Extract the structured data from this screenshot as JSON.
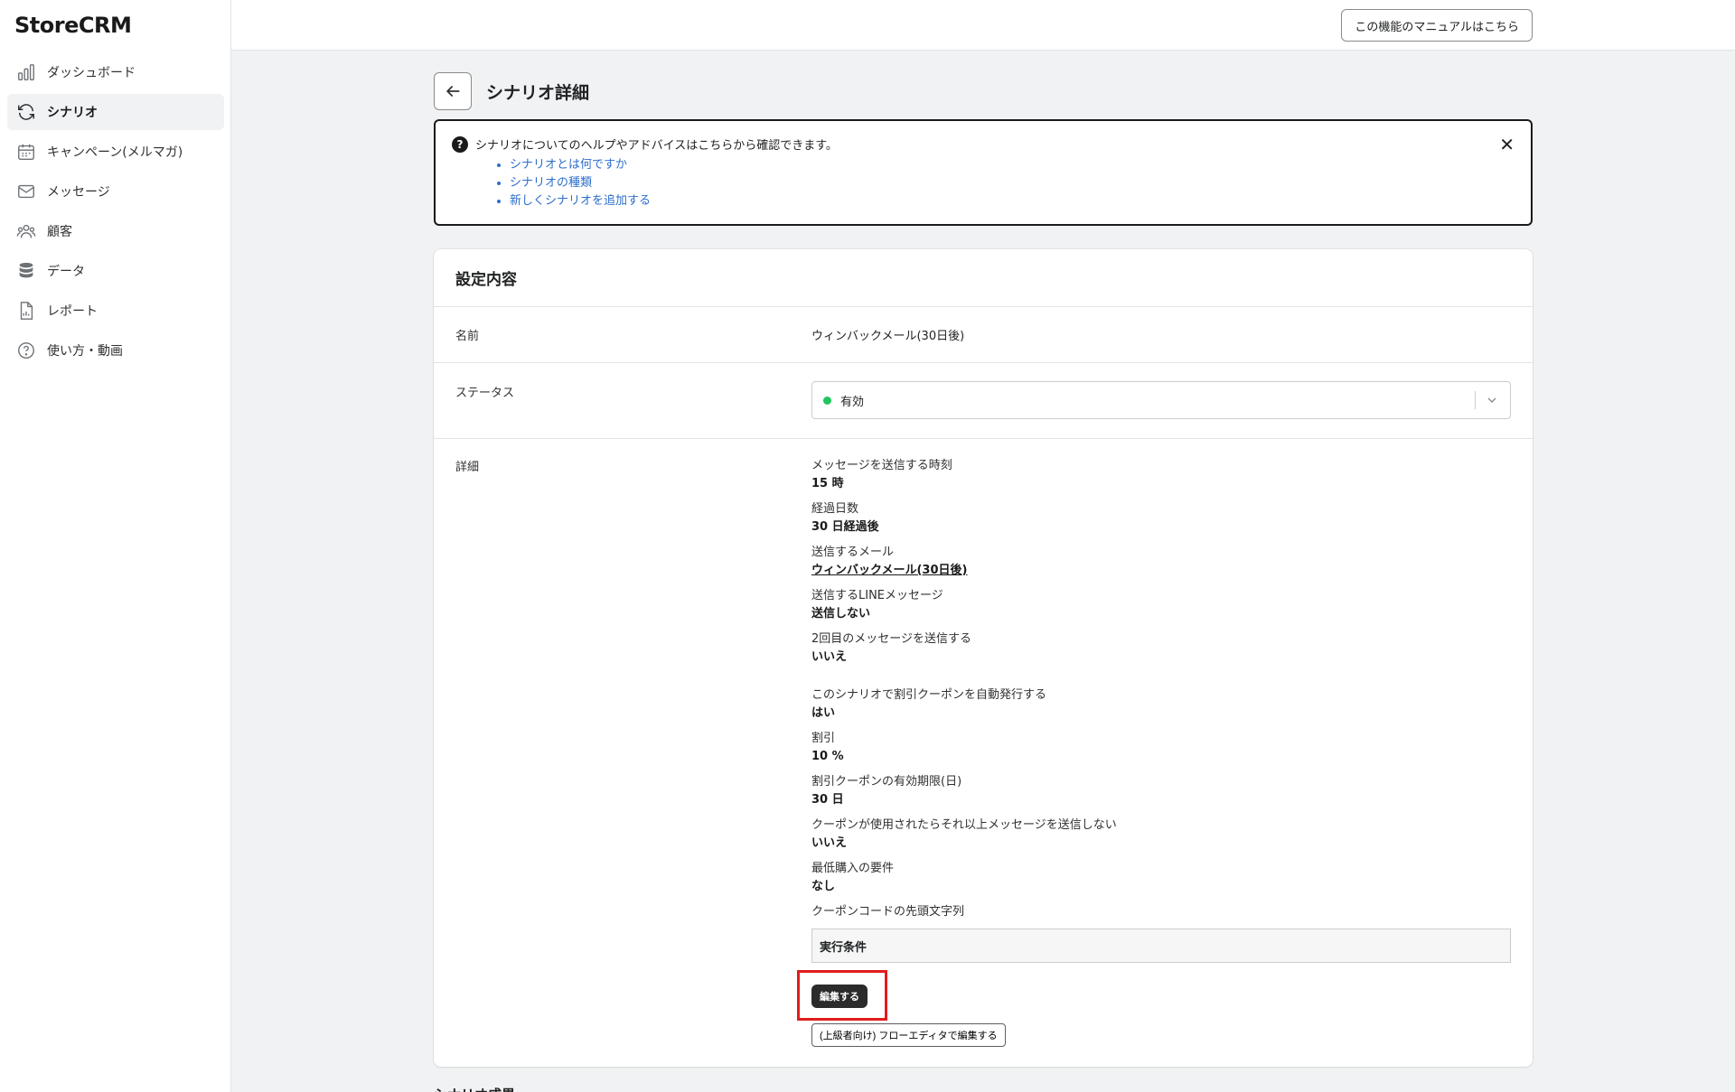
{
  "app": {
    "logo": "StoreCRM"
  },
  "sidebar": {
    "items": [
      {
        "label": "ダッシュボード",
        "icon": "bar-chart-icon"
      },
      {
        "label": "シナリオ",
        "icon": "refresh-icon",
        "active": true
      },
      {
        "label": "キャンペーン(メルマガ)",
        "icon": "calendar-icon"
      },
      {
        "label": "メッセージ",
        "icon": "mail-icon"
      },
      {
        "label": "顧客",
        "icon": "users-icon"
      },
      {
        "label": "データ",
        "icon": "database-icon"
      },
      {
        "label": "レポート",
        "icon": "report-icon"
      },
      {
        "label": "使い方・動画",
        "icon": "help-circle-icon"
      }
    ]
  },
  "topbar": {
    "manual_button": "この機能のマニュアルはこちら"
  },
  "page": {
    "title": "シナリオ詳細"
  },
  "help": {
    "heading": "シナリオについてのヘルプやアドバイスはこちらから確認できます。",
    "links": [
      "シナリオとは何ですか",
      "シナリオの種類",
      "新しくシナリオを追加する"
    ]
  },
  "settings": {
    "title": "設定内容",
    "name_label": "名前",
    "name_value": "ウィンバックメール(30日後)",
    "status_label": "ステータス",
    "status_value": "有効",
    "status_color": "#22c55e",
    "detail_label": "詳細",
    "details": [
      {
        "label": "メッセージを送信する時刻",
        "value": "15 時"
      },
      {
        "label": "経過日数",
        "value": "30 日経過後"
      },
      {
        "label": "送信するメール",
        "value": "ウィンバックメール(30日後)"
      },
      {
        "label": "送信するLINEメッセージ",
        "value": "送信しない"
      },
      {
        "label": "2回目のメッセージを送信する",
        "value": "いいえ"
      },
      {
        "label": "このシナリオで割引クーポンを自動発行する",
        "value": "はい"
      },
      {
        "label": "割引",
        "value": "10 %"
      },
      {
        "label": "割引クーポンの有効期限(日)",
        "value": "30 日"
      },
      {
        "label": "クーポンが使用されたらそれ以上メッセージを送信しない",
        "value": "いいえ"
      },
      {
        "label": "最低購入の要件",
        "value": "なし"
      },
      {
        "label": "クーポンコードの先頭文字列",
        "value": ""
      }
    ],
    "exec_condition": "実行条件",
    "edit_button": "編集する",
    "flow_button": "(上級者向け) フローエディタで編集する"
  },
  "results": {
    "title": "シナリオ成果"
  }
}
